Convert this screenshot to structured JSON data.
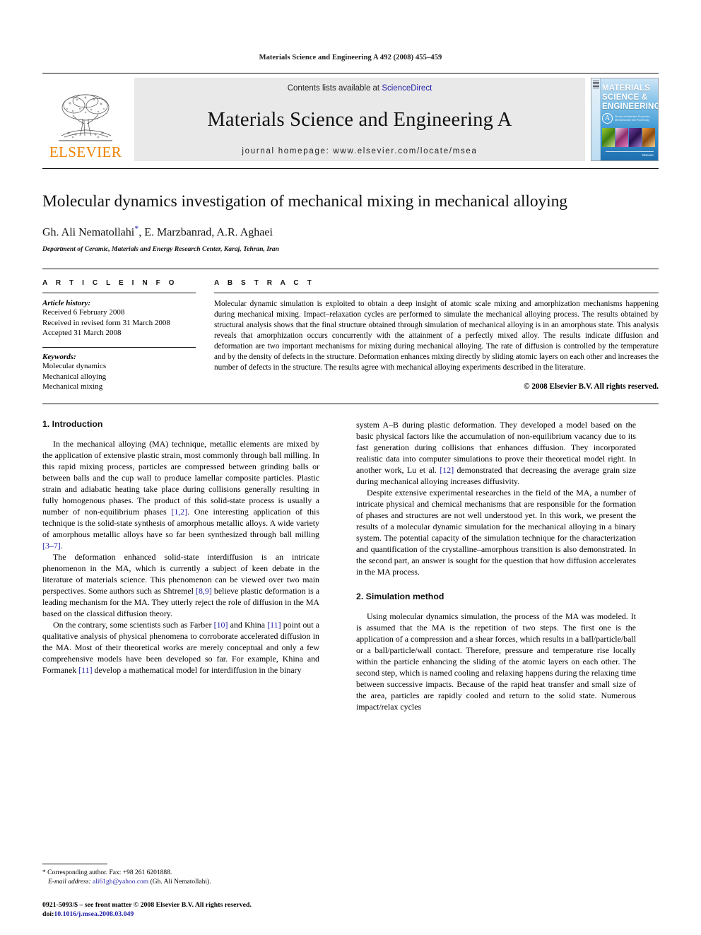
{
  "running_head": "Materials Science and Engineering A 492 (2008) 455–459",
  "banner": {
    "contents_prefix": "Contents lists available at ",
    "sciencedirect": "ScienceDirect",
    "journal_title": "Materials Science and Engineering A",
    "homepage": "journal homepage: www.elsevier.com/locate/msea",
    "publisher": "ELSEVIER",
    "cover": {
      "line1": "MATERIALS",
      "line2": "SCIENCE &",
      "line3": "ENGINEERING",
      "badge": "A",
      "subtitle": "Structural Materials: Properties, Microstructure and Processing",
      "footer": "Elsevier"
    },
    "link_color": "#1f1fa8",
    "brand_color": "#ef8200"
  },
  "article": {
    "title": "Molecular dynamics investigation of mechanical mixing in mechanical alloying",
    "authors": "Gh. Ali Nematollahi",
    "corresponding_marker": "*",
    "authors_rest": ", E. Marzbanrad, A.R. Aghaei",
    "affiliation": "Department of Ceramic, Materials and Energy Research Center, Karaj, Tehran, Iran"
  },
  "info": {
    "heading": "A R T I C L E  I N F O",
    "history_label": "Article history:",
    "history": [
      "Received 6 February 2008",
      "Received in revised form 31 March 2008",
      "Accepted 31 March 2008"
    ],
    "keywords_label": "Keywords:",
    "keywords": [
      "Molecular dynamics",
      "Mechanical alloying",
      "Mechanical mixing"
    ]
  },
  "abstract": {
    "heading": "A B S T R A C T",
    "text": "Molecular dynamic simulation is exploited to obtain a deep insight of atomic scale mixing and amorphization mechanisms happening during mechanical mixing. Impact–relaxation cycles are performed to simulate the mechanical alloying process. The results obtained by structural analysis shows that the final structure obtained through simulation of mechanical alloying is in an amorphous state. This analysis reveals that amorphization occurs concurrently with the attainment of a perfectly mixed alloy. The results indicate diffusion and deformation are two important mechanisms for mixing during mechanical alloying. The rate of diffusion is controlled by the temperature and by the density of defects in the structure. Deformation enhances mixing directly by sliding atomic layers on each other and increases the number of defects in the structure. The results agree with mechanical alloying experiments described in the literature.",
    "copyright": "© 2008 Elsevier B.V. All rights reserved."
  },
  "sections": {
    "intro_heading": "1.  Introduction",
    "method_heading": "2.  Simulation method"
  },
  "left_column": {
    "p1_a": "In the mechanical alloying (MA) technique, metallic elements are mixed by the application of extensive plastic strain, most commonly through ball milling. In this rapid mixing process, particles are compressed between grinding balls or between balls and the cup wall to produce lamellar composite particles. Plastic strain and adiabatic heating take place during collisions generally resulting in fully homogenous phases. The product of this solid-state process is usually a number of non-equilibrium phases ",
    "p1_ref1": "[1,2]",
    "p1_b": ". One interesting application of this technique is the solid-state synthesis of amorphous metallic alloys. A wide variety of amorphous metallic alloys have so far been synthesized through ball milling ",
    "p1_ref2": "[3–7]",
    "p1_c": ".",
    "p2_a": "The deformation enhanced solid-state interdiffusion is an intricate phenomenon in the MA, which is currently a subject of keen debate in the literature of materials science. This phenomenon can be viewed over two main perspectives. Some authors such as Shtremel ",
    "p2_ref1": "[8,9]",
    "p2_b": " believe plastic deformation is a leading mechanism for the MA. They utterly reject the role of diffusion in the MA based on the classical diffusion theory.",
    "p3_a": "On the contrary, some scientists such as Farber ",
    "p3_ref1": "[10]",
    "p3_b": " and Khina ",
    "p3_ref2": "[11]",
    "p3_c": " point out a qualitative analysis of physical phenomena to corroborate accelerated diffusion in the MA. Most of their theoretical works are merely conceptual and only a few comprehensive models have been developed so far. For example, Khina and Formanek ",
    "p3_ref3": "[11]",
    "p3_d": " develop a mathematical model for interdiffusion in the binary"
  },
  "right_column": {
    "p1_a": "system A–B during plastic deformation. They developed a model based on the basic physical factors like the accumulation of non-equilibrium vacancy due to its fast generation during collisions that enhances diffusion. They incorporated realistic data into computer simulations to prove their theoretical model right. In another work, Lu et al. ",
    "p1_ref1": "[12]",
    "p1_b": " demonstrated that decreasing the average grain size during mechanical alloying increases diffusivity.",
    "p2": "Despite extensive experimental researches in the field of the MA, a number of intricate physical and chemical mechanisms that are responsible for the formation of phases and structures are not well understood yet. In this work, we present the results of a molecular dynamic simulation for the mechanical alloying in a binary system. The potential capacity of the simulation technique for the characterization and quantification of the crystalline–amorphous transition is also demonstrated. In the second part, an answer is sought for the question that how diffusion accelerates in the MA process.",
    "p3": "Using molecular dynamics simulation, the process of the MA was modeled. It is assumed that the MA is the repetition of two steps. The first one is the application of a compression and a shear forces, which results in a ball/particle/ball or a ball/particle/wall contact. Therefore, pressure and temperature rise locally within the particle enhancing the sliding of the atomic layers on each other. The second step, which is named cooling and relaxing happens during the relaxing time between successive impacts. Because of the rapid heat transfer and small size of the area, particles are rapidly cooled and return to the solid state. Numerous impact/relax cycles"
  },
  "footnote": {
    "corresponding": "* Corresponding author. Fax: +98 261 6201888.",
    "email_label": "E-mail address:",
    "email": "ali61gh@yahoo.com",
    "email_suffix": "(Gh. Ali Nematollahi)."
  },
  "imprint": {
    "issn_line": "0921-5093/$ – see front matter © 2008 Elsevier B.V. All rights reserved.",
    "doi_label": "doi:",
    "doi": "10.1016/j.msea.2008.03.049"
  }
}
